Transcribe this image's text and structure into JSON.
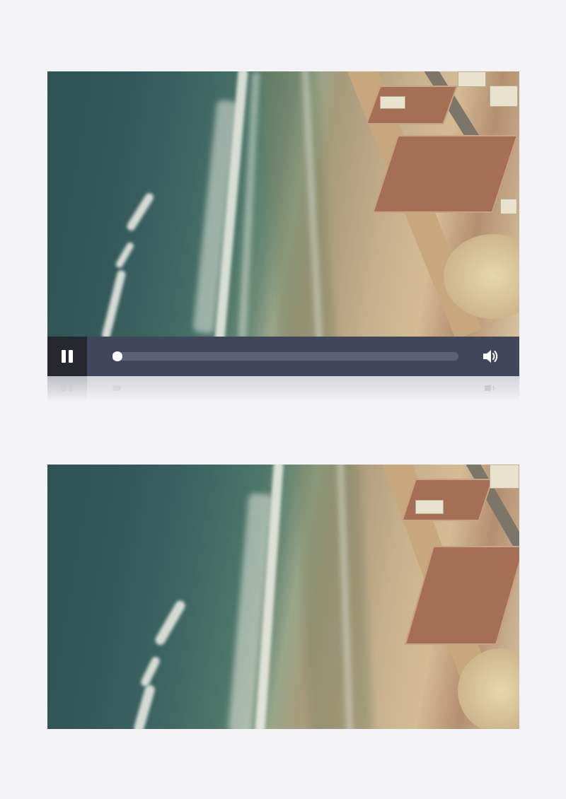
{
  "player": {
    "state": "playing",
    "progress_fraction": 0.0,
    "icons": {
      "play_toggle": "pause-icon",
      "volume": "volume-icon"
    },
    "colors": {
      "control_bar": "#41465a",
      "play_button_bg": "#27282f",
      "progress_track": "#5e6276",
      "handle": "#ffffff"
    }
  },
  "frames": [
    {
      "name": "video-frame",
      "scene": "aerial-beach"
    },
    {
      "name": "still-frame",
      "scene": "aerial-beach"
    }
  ],
  "page": {
    "background": "#f3f3f5"
  }
}
